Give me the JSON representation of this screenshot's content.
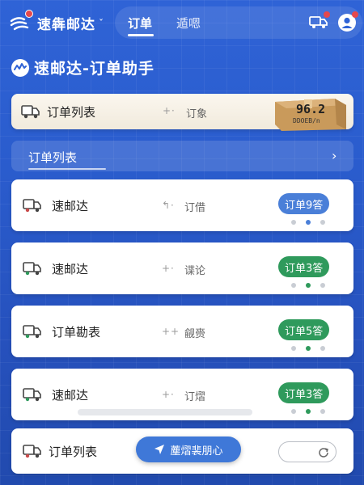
{
  "header": {
    "brand_name": "速犇邮达",
    "brand_caret": "ˇ",
    "tabs": [
      {
        "label": "订单"
      },
      {
        "label": "遁嗯"
      }
    ]
  },
  "section": {
    "title": "速邮达-订单助手"
  },
  "summary_card": {
    "label": "订单列表",
    "mid_glyph": "+·",
    "mid_label": "订象",
    "box_text": "96.2",
    "box_subtext": "DDOEB/n"
  },
  "list_header": {
    "label": "订单列表",
    "chevron": "›"
  },
  "orders": [
    {
      "name": "速邮达",
      "mid_glyph": "↰·",
      "mid_label": "订借",
      "badge": "订单9答",
      "badge_color": "#4a7fd8",
      "active_dot": 1
    },
    {
      "name": "速邮达",
      "mid_glyph": "+·",
      "mid_label": "谍论",
      "badge": "订单3答",
      "badge_color": "#2f9a5c",
      "active_dot": 1
    },
    {
      "name": "订单勘表",
      "mid_glyph": "++",
      "mid_label": "觎赍",
      "badge": "订单5答",
      "badge_color": "#2f9a5c",
      "active_dot": 1
    },
    {
      "name": "速邮达",
      "mid_glyph": "+·",
      "mid_label": "订熠",
      "badge": "订单3答",
      "badge_color": "#2f9a5c",
      "active_dot": 1
    }
  ],
  "bottom_card": {
    "label": "订单列表"
  },
  "fab": {
    "label": "薼熠裴朋心"
  },
  "colors": {
    "primary_blue": "#2f63d6",
    "badge_blue": "#4a7fd8",
    "badge_green": "#2f9a5c",
    "notify_red": "#e5484d"
  }
}
